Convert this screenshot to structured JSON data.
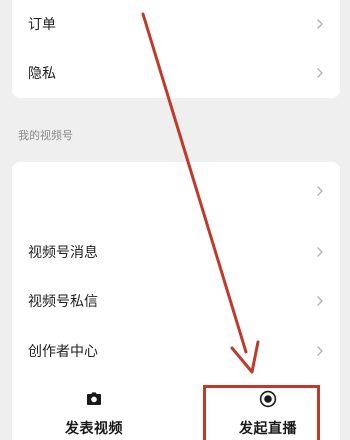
{
  "top_card": {
    "items": [
      {
        "label": "订单"
      },
      {
        "label": "隐私"
      }
    ]
  },
  "channel_section": {
    "title": "我的视频号",
    "items": [
      {
        "label": ""
      },
      {
        "label": "视频号消息"
      },
      {
        "label": "视频号私信"
      },
      {
        "label": "创作者中心"
      }
    ],
    "actions": {
      "post_video": {
        "label": "发表视频",
        "icon": "camera-icon"
      },
      "start_live": {
        "label": "发起直播",
        "icon": "live-record-icon"
      }
    }
  },
  "annotation": {
    "color": "#c0392b",
    "highlight": "start_live"
  }
}
